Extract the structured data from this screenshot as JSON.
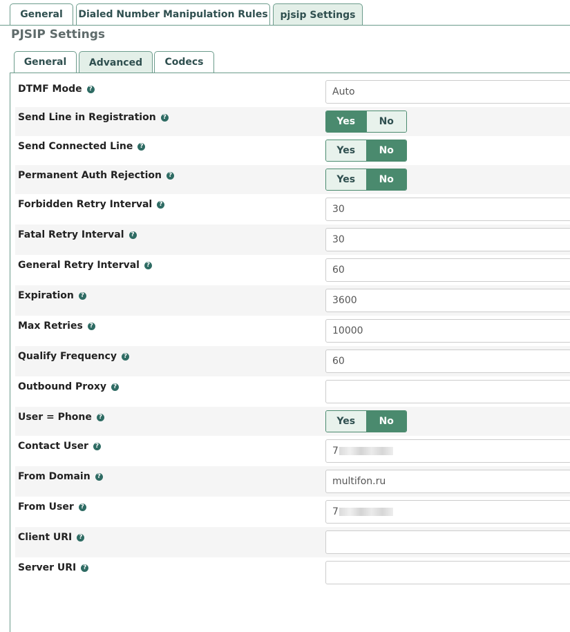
{
  "top_tabs": [
    "General",
    "Dialed Number Manipulation Rules",
    "pjsip Settings"
  ],
  "section_title": "PJSIP Settings",
  "sub_tabs": [
    "General",
    "Advanced",
    "Codecs"
  ],
  "help_icon": "?",
  "yes_label": "Yes",
  "no_label": "No",
  "fields": {
    "dtmf_mode": {
      "label": "DTMF Mode",
      "value": "Auto"
    },
    "send_line_in_registration": {
      "label": "Send Line in Registration",
      "value": "Yes"
    },
    "send_connected_line": {
      "label": "Send Connected Line",
      "value": "No"
    },
    "permanent_auth_rejection": {
      "label": "Permanent Auth Rejection",
      "value": "No"
    },
    "forbidden_retry_interval": {
      "label": "Forbidden Retry Interval",
      "value": "30"
    },
    "fatal_retry_interval": {
      "label": "Fatal Retry Interval",
      "value": "30"
    },
    "general_retry_interval": {
      "label": "General Retry Interval",
      "value": "60"
    },
    "expiration": {
      "label": "Expiration",
      "value": "3600"
    },
    "max_retries": {
      "label": "Max Retries",
      "value": "10000"
    },
    "qualify_frequency": {
      "label": "Qualify Frequency",
      "value": "60"
    },
    "outbound_proxy": {
      "label": "Outbound Proxy",
      "value": ""
    },
    "user_phone": {
      "label": "User = Phone",
      "value": "No"
    },
    "contact_user": {
      "label": "Contact User",
      "value": "7"
    },
    "from_domain": {
      "label": "From Domain",
      "value": "multifon.ru"
    },
    "from_user": {
      "label": "From User",
      "value": "7"
    },
    "client_uri": {
      "label": "Client URI",
      "value": ""
    },
    "server_uri": {
      "label": "Server URI",
      "value": ""
    }
  },
  "colors": {
    "accent": "#4a8a6e",
    "tab_active_bg": "#e3efe8",
    "row_alt_bg": "#f5f5f5",
    "help_icon": "#2e6b63"
  }
}
